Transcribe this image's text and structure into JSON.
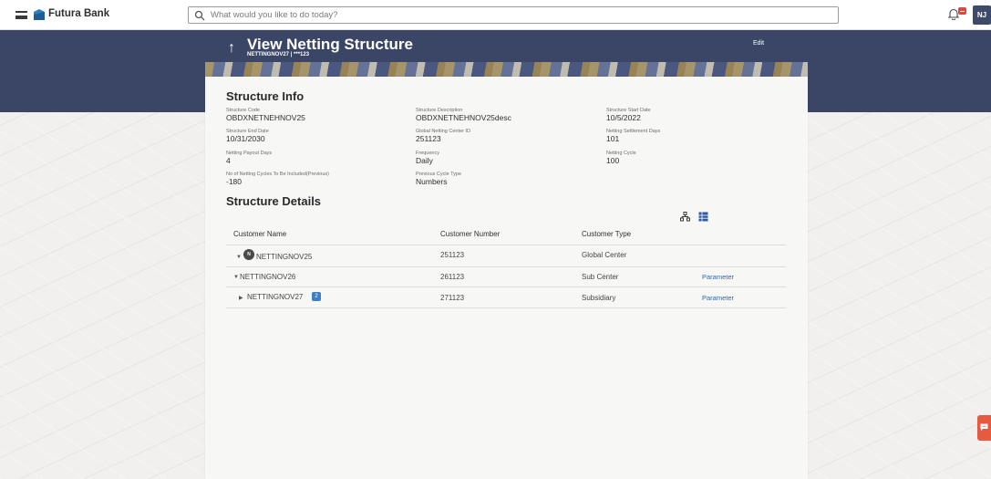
{
  "app": {
    "brand": "Futura Bank"
  },
  "search": {
    "placeholder": "What would you like to do today?"
  },
  "user": {
    "initials": "NJ"
  },
  "header": {
    "title": "View Netting Structure",
    "subtitle": "NETTINGNOV27 | ***123",
    "edit_label": "Edit"
  },
  "structure_info": {
    "title": "Structure Info",
    "fields": [
      {
        "label": "Structure Code",
        "value": "OBDXNETNEHNOV25"
      },
      {
        "label": "Structure Description",
        "value": "OBDXNETNEHNOV25desc"
      },
      {
        "label": "Structure Start Date",
        "value": "10/5/2022"
      },
      {
        "label": "Structure End Date",
        "value": "10/31/2030"
      },
      {
        "label": "Global Netting Center ID",
        "value": "251123"
      },
      {
        "label": "Netting Settlement Days",
        "value": "101"
      },
      {
        "label": "Netting Payout Days",
        "value": "4"
      },
      {
        "label": "Frequency",
        "value": "Daily"
      },
      {
        "label": "Netting Cycle",
        "value": "100"
      },
      {
        "label": "No of Netting Cycles To Be Included(Previous)",
        "value": "-180"
      },
      {
        "label": "Previous Cycle Type",
        "value": "Numbers"
      }
    ]
  },
  "structure_details": {
    "title": "Structure Details",
    "columns": [
      "Customer Name",
      "Customer Number",
      "Customer Type"
    ],
    "rows": [
      {
        "name": "NETTINGNOV25",
        "node_initial": "N",
        "number": "251123",
        "type": "Global Center",
        "action": ""
      },
      {
        "name": "NETTINGNOV26",
        "number": "261123",
        "type": "Sub Center",
        "action": "Parameter"
      },
      {
        "name": "NETTINGNOV27",
        "badge": "2",
        "number": "271123",
        "type": "Subsidiary",
        "action": "Parameter"
      }
    ]
  },
  "colors": {
    "header": "#3b4566",
    "link": "#2d68b0",
    "accent": "#e55b3f"
  }
}
